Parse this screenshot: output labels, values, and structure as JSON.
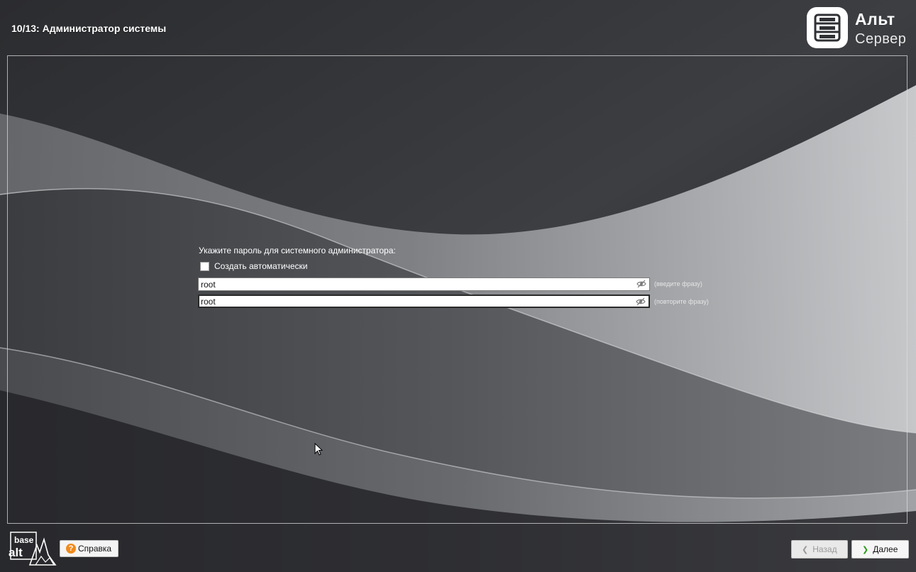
{
  "header": {
    "step_title": "10/13: Администратор системы",
    "brand_name": "Альт",
    "brand_sub": "Сервер"
  },
  "form": {
    "prompt": "Укажите пароль для системного администратора:",
    "auto_generate": {
      "label": "Создать автоматически",
      "checked": false
    },
    "password": {
      "value": "root",
      "hint": "(введите фразу)"
    },
    "password_confirm": {
      "value": "root",
      "hint": "(повторите фразу)"
    }
  },
  "footer": {
    "logo_text_top": "base",
    "logo_text_bottom": "alt",
    "help_label": "Справка",
    "back_label": "Назад",
    "next_label": "Далее"
  },
  "icons": {
    "help": "question-circle-icon",
    "password_toggle": "eye-crossed-icon",
    "back": "chevron-left-icon",
    "next": "chevron-right-icon"
  },
  "colors": {
    "background": "#2d2f32",
    "help_icon": "#f08a1c",
    "next_chevron": "#2f9a1e"
  }
}
